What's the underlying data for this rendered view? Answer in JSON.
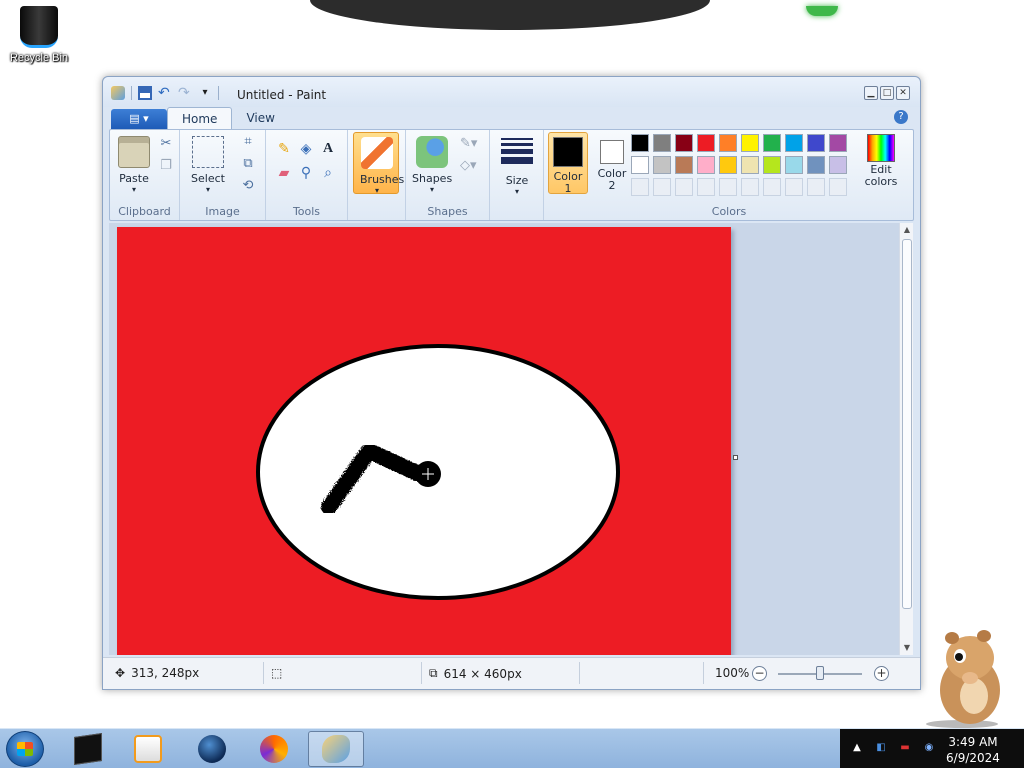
{
  "desktop": {
    "icons": [
      {
        "label": "Recycle Bin",
        "icon": "recycle-bin-icon"
      }
    ]
  },
  "window": {
    "title": "Untitled - Paint",
    "tabs": [
      {
        "label": "Home",
        "active": true
      },
      {
        "label": "View",
        "active": false
      }
    ],
    "file_menu_icon": "file-menu-icon"
  },
  "ribbon": {
    "groups": {
      "clipboard": {
        "label": "Clipboard",
        "paste_label": "Paste"
      },
      "image": {
        "label": "Image",
        "select_label": "Select"
      },
      "tools": {
        "label": "Tools"
      },
      "brushes": {
        "label": "Brushes"
      },
      "shapes": {
        "label": "Shapes",
        "button_label": "Shapes"
      },
      "size": {
        "label": "Size"
      },
      "colors": {
        "label": "Colors",
        "color1_label": "Color",
        "color1_num": "1",
        "color2_label": "Color",
        "color2_num": "2",
        "color1_value": "#000000",
        "color2_value": "#ffffff",
        "edit_label_1": "Edit",
        "edit_label_2": "colors",
        "palette_row1": [
          "#000000",
          "#7f7f7f",
          "#880015",
          "#ed1c24",
          "#ff7f27",
          "#fff200",
          "#22b14c",
          "#00a2e8",
          "#3f48cc",
          "#a349a4"
        ],
        "palette_row2": [
          "#ffffff",
          "#c3c3c3",
          "#b97a57",
          "#ffaec9",
          "#ffc90e",
          "#efe4b0",
          "#b5e61d",
          "#99d9ea",
          "#7092be",
          "#c8bfe7"
        ]
      }
    }
  },
  "canvas": {
    "background": "#ed1c24",
    "ellipse_fill": "#ffffff",
    "ellipse_stroke": "#000000",
    "stroke_color": "#000000"
  },
  "status": {
    "cursor_pos": "313, 248px",
    "canvas_size": "614 × 460px",
    "zoom": "100%"
  },
  "taskbar": {
    "items": [
      "terminal-icon",
      "media-player-icon",
      "globe-icon",
      "firefox-icon",
      "paint-icon"
    ],
    "active": "paint-icon",
    "time": "3:49 AM",
    "date": "6/9/2024"
  }
}
